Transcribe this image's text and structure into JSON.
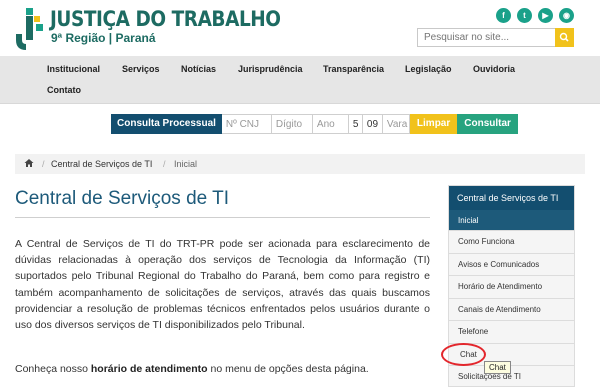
{
  "header": {
    "logo_title": "JUSTIÇA DO TRABALHO",
    "logo_subtitle": "9ª Região | Paraná",
    "brand_color": "#1d6b62",
    "social": [
      {
        "icon": "facebook-icon",
        "glyph": "f"
      },
      {
        "icon": "twitter-icon",
        "glyph": "t"
      },
      {
        "icon": "youtube-icon",
        "glyph": "▶"
      },
      {
        "icon": "rss-icon",
        "glyph": "◉"
      }
    ],
    "search_placeholder": "Pesquisar no site...",
    "search_icon": "search-icon"
  },
  "nav": {
    "items": [
      "Institucional",
      "Serviços",
      "Notícias",
      "Jurisprudência",
      "Transparência",
      "Legislação",
      "Ouvidoria",
      "Contato"
    ]
  },
  "consulta": {
    "title": "Consulta Processual",
    "fields": [
      "Nº CNJ",
      "Dígito",
      "Ano",
      "5",
      "09",
      "Vara"
    ],
    "clear_label": "Limpar",
    "submit_label": "Consultar",
    "colors": {
      "title": "#134e6f",
      "clear": "#f1c21b",
      "submit": "#27a37f"
    }
  },
  "breadcrumb": {
    "home_icon": "home-icon",
    "items": [
      "Central de Serviços de TI",
      "Inicial"
    ]
  },
  "main": {
    "title": "Central de Serviços de TI",
    "paragraph": "A Central de Serviços de TI do TRT-PR pode ser acionada para esclarecimento de dúvidas relacionadas à operação dos serviços de Tecnologia da Informação (TI) suportados pelo Tribunal Regional do Trabalho do Paraná, bem como para registro e também acompanhamento de solicitações de serviços, através das quais buscamos providenciar a resolução de problemas técnicos enfrentados pelos usuários durante o uso dos diversos serviços de TI disponibilizados pelo Tribunal.",
    "note_prefix": "Conheça nosso ",
    "note_bold": "horário de atendimento",
    "note_suffix": " no menu de opções desta página."
  },
  "sidebar": {
    "title": "Central de Serviços de TI",
    "items": [
      "Inicial",
      "Como Funciona",
      "Avisos e Comunicados",
      "Horário de Atendimento",
      "Canais de Atendimento",
      "Telefone",
      "Chat",
      "Solicitações de TI"
    ],
    "active_index": 0
  },
  "tooltip": "Chat",
  "highlight_color": "#e3262c"
}
